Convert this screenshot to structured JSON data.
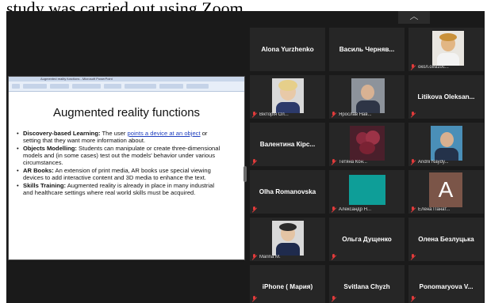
{
  "caption": "study was carried out using Zoom.",
  "toolbar": {
    "chevron_icon": "chevron-up-icon"
  },
  "shared_screen": {
    "window_title": "Augmented reality functions - Microsoft PowerPoint",
    "slide": {
      "title": "Augmented reality functions",
      "bullets": [
        {
          "head": "Discovery-based Learning:",
          "text": " The user ",
          "link": "points a device at an object",
          "tail": " or setting that they want more information about."
        },
        {
          "head": "Objects Modelling:",
          "text": " Students can manipulate or create three-dimensional models and (in some cases) test out the models' behavior under various circumstances.",
          "link": "",
          "tail": ""
        },
        {
          "head": "AR Books:",
          "text": " An extension of print media, AR books use special viewing devices to add interactive content and 3D media to enhance the text.",
          "link": "",
          "tail": ""
        },
        {
          "head": "Skills Training:",
          "text": " Augmented reality is already in place in many industrial and healthcare settings where real world skills must be acquired.",
          "link": "",
          "tail": ""
        }
      ]
    }
  },
  "participants": [
    {
      "name": "Alona Yurzhenko",
      "label": "",
      "video": false,
      "muted": false
    },
    {
      "name": "Василь Черняв...",
      "label": "",
      "video": false,
      "muted": false
    },
    {
      "name": "",
      "label": "окол.сеа1ос...",
      "video": true,
      "muted": true
    },
    {
      "name": "",
      "label": "Вікторія Ол...",
      "video": true,
      "muted": true
    },
    {
      "name": "",
      "label": "Ярослав Нав...",
      "video": true,
      "muted": true
    },
    {
      "name": "Litikova Oleksan...",
      "label": "",
      "video": false,
      "muted": true
    },
    {
      "name": "Валентина Кірс...",
      "label": "",
      "video": false,
      "muted": true
    },
    {
      "name": "",
      "label": "Тетяна Кон...",
      "video": true,
      "muted": true
    },
    {
      "name": "",
      "label": "Andrii Naydy...",
      "video": true,
      "muted": true
    },
    {
      "name": "Olha Romanovska",
      "label": "",
      "video": false,
      "muted": true
    },
    {
      "name": "",
      "label": "Александр Н...",
      "video": true,
      "muted": true
    },
    {
      "name": "",
      "label": "Елена Панат...",
      "video": true,
      "muted": true,
      "avatar_letter": "A"
    },
    {
      "name": "",
      "label": "Marina M.",
      "video": true,
      "muted": true
    },
    {
      "name": "Ольга Дущенко",
      "label": "",
      "video": false,
      "muted": true
    },
    {
      "name": "Олена Безлуцька",
      "label": "",
      "video": false,
      "muted": true
    },
    {
      "name": "iPhone ( Мария)",
      "label": "",
      "video": false,
      "muted": true
    },
    {
      "name": "Svitlana Chyzh",
      "label": "",
      "video": false,
      "muted": true
    },
    {
      "name": "Ponomaryova V...",
      "label": "",
      "video": false,
      "muted": true
    }
  ]
}
